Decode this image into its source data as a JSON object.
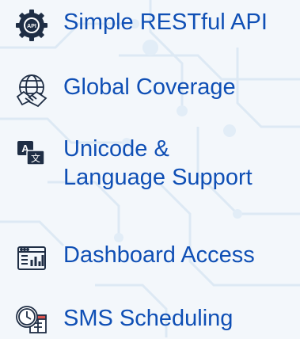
{
  "features": [
    {
      "label": "Simple RESTful API",
      "icon": "api-gear-icon"
    },
    {
      "label": "Global Coverage",
      "icon": "globe-handshake-icon"
    },
    {
      "label_line1": "Unicode &",
      "label_line2": "Language Support",
      "icon": "translate-icon"
    },
    {
      "label": "Dashboard Access",
      "icon": "dashboard-icon"
    },
    {
      "label": "SMS Scheduling",
      "icon": "clock-calendar-icon"
    }
  ],
  "api_badge": "API",
  "translate_glyphs": {
    "top": "A",
    "bottom": "文"
  },
  "colors": {
    "text": "#0f4fb5",
    "icon_dark": "#1f2e45",
    "background": "#f3f7fb",
    "circuit": "#dce8f3",
    "accent_red": "#d9534f"
  }
}
